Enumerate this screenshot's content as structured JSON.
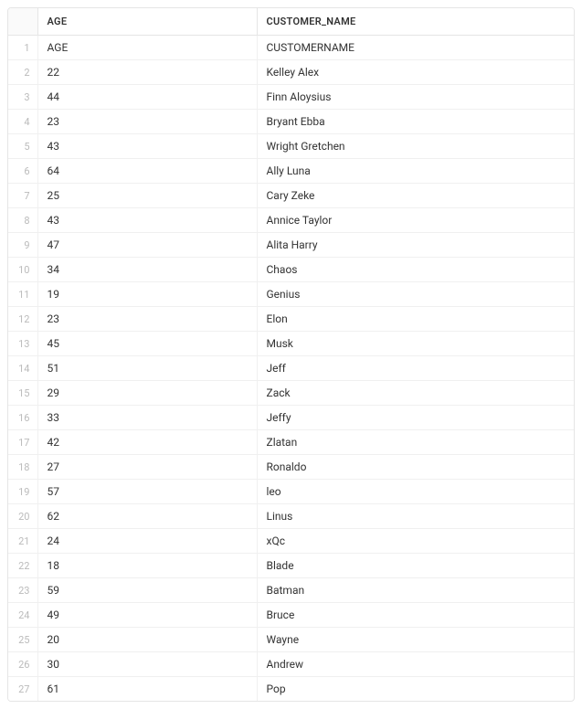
{
  "table": {
    "columns": [
      "AGE",
      "CUSTOMER_NAME"
    ],
    "rows": [
      {
        "num": "1",
        "age": "AGE",
        "customer_name": "CUSTOMERNAME"
      },
      {
        "num": "2",
        "age": "22",
        "customer_name": "Kelley Alex"
      },
      {
        "num": "3",
        "age": "44",
        "customer_name": "Finn Aloysius"
      },
      {
        "num": "4",
        "age": "23",
        "customer_name": "Bryant Ebba"
      },
      {
        "num": "5",
        "age": "43",
        "customer_name": "Wright Gretchen"
      },
      {
        "num": "6",
        "age": "64",
        "customer_name": "Ally Luna"
      },
      {
        "num": "7",
        "age": "25",
        "customer_name": "Cary Zeke"
      },
      {
        "num": "8",
        "age": "43",
        "customer_name": "Annice Taylor"
      },
      {
        "num": "9",
        "age": "47",
        "customer_name": "Alita Harry"
      },
      {
        "num": "10",
        "age": "34",
        "customer_name": "Chaos"
      },
      {
        "num": "11",
        "age": "19",
        "customer_name": "Genius"
      },
      {
        "num": "12",
        "age": "23",
        "customer_name": "Elon"
      },
      {
        "num": "13",
        "age": "45",
        "customer_name": "Musk"
      },
      {
        "num": "14",
        "age": "51",
        "customer_name": "Jeff"
      },
      {
        "num": "15",
        "age": "29",
        "customer_name": "Zack"
      },
      {
        "num": "16",
        "age": "33",
        "customer_name": "Jeffy"
      },
      {
        "num": "17",
        "age": "42",
        "customer_name": "Zlatan"
      },
      {
        "num": "18",
        "age": "27",
        "customer_name": "Ronaldo"
      },
      {
        "num": "19",
        "age": "57",
        "customer_name": "leo"
      },
      {
        "num": "20",
        "age": "62",
        "customer_name": "Linus"
      },
      {
        "num": "21",
        "age": "24",
        "customer_name": "xQc"
      },
      {
        "num": "22",
        "age": "18",
        "customer_name": "Blade"
      },
      {
        "num": "23",
        "age": "59",
        "customer_name": "Batman"
      },
      {
        "num": "24",
        "age": "49",
        "customer_name": "Bruce"
      },
      {
        "num": "25",
        "age": "20",
        "customer_name": "Wayne"
      },
      {
        "num": "26",
        "age": "30",
        "customer_name": "Andrew"
      },
      {
        "num": "27",
        "age": "61",
        "customer_name": "Pop"
      }
    ]
  }
}
